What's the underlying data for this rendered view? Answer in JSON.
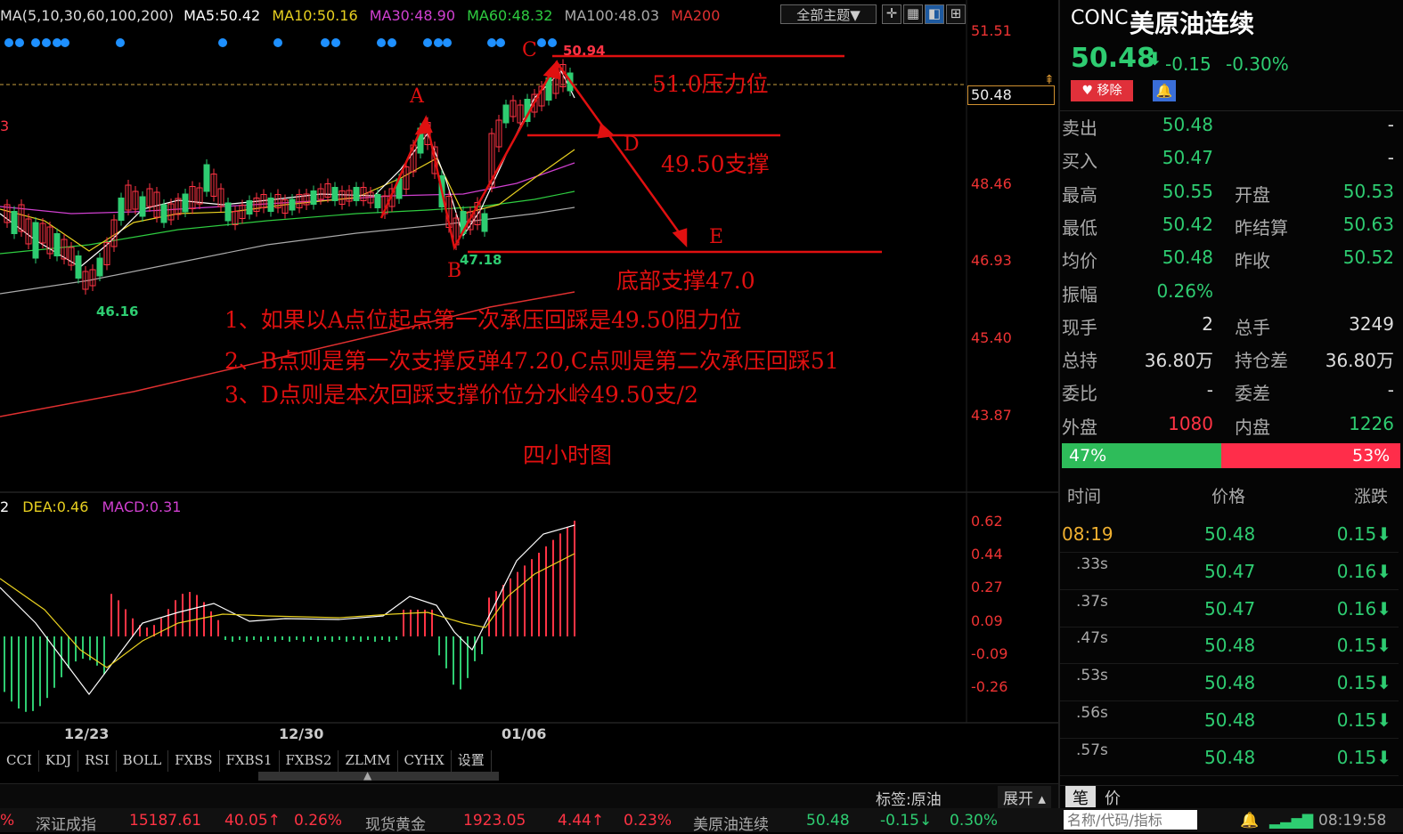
{
  "ma_legend": {
    "params": "MA(5,10,30,60,100,200)",
    "ma5": "MA5:50.42",
    "ma10": "MA10:50.16",
    "ma30": "MA30:48.90",
    "ma60": "MA60:48.32",
    "ma100": "MA100:48.03",
    "ma200": "MA200"
  },
  "toolbar": {
    "theme_label": "全部主题▼"
  },
  "price_axis": [
    "51.51",
    "48.46",
    "46.93",
    "45.40",
    "43.87"
  ],
  "current_price_tag": "50.48",
  "high_label": "50.94",
  "low_label_left": "46.16",
  "low_label_b": "47.18",
  "left_partial_label": "3",
  "points": {
    "a": "A",
    "b": "B",
    "c": "C",
    "d": "D",
    "e": "E"
  },
  "annotations": {
    "resistance": "51.0压力位",
    "support_mid": "49.50支撑",
    "support_bottom": "底部支撑47.0",
    "note1": "1、如果以A点位起点第一次承压回踩是49.50阻力位",
    "note2": "2、B点则是第一次支撑反弹47.20,C点则是第二次承压回踩51",
    "note3": "3、D点则是本次回踩支撑价位分水岭49.50支/2",
    "timeframe": "四小时图"
  },
  "macd_legend": {
    "dif_partial": "2",
    "dea": "DEA:0.46",
    "macd": "MACD:0.31"
  },
  "macd_axis": [
    "0.62",
    "0.44",
    "0.27",
    "0.09",
    "-0.09",
    "-0.26"
  ],
  "date_axis": [
    "12/23",
    "12/30",
    "01/06"
  ],
  "indicator_tabs": [
    "CCI",
    "KDJ",
    "RSI",
    "BOLL",
    "FXBS",
    "FXBS1",
    "FXBS2",
    "ZLMM",
    "CYHX",
    "设置"
  ],
  "bottom_bar": {
    "tag": "标签:原油",
    "expand": "展开 ▴"
  },
  "quote": {
    "code": "CONC",
    "name": "美原油连续",
    "price": "50.48",
    "arrow": "⬇",
    "change": "-0.15",
    "change_pct": "-0.30%",
    "remove_label": "移除",
    "rows": [
      {
        "l1": "卖出",
        "v1": "50.48",
        "l2": "",
        "v2": "-"
      },
      {
        "l1": "买入",
        "v1": "50.47",
        "l2": "",
        "v2": "-"
      },
      {
        "l1": "最高",
        "v1": "50.55",
        "l2": "开盘",
        "v2": "50.53"
      },
      {
        "l1": "最低",
        "v1": "50.42",
        "l2": "昨结算",
        "v2": "50.63"
      },
      {
        "l1": "均价",
        "v1": "50.48",
        "l2": "昨收",
        "v2": "50.52"
      },
      {
        "l1": "振幅",
        "v1": "0.26%",
        "l2": "",
        "v2": ""
      },
      {
        "l1": "现手",
        "v1": "2",
        "l2": "总手",
        "v2": "3249"
      },
      {
        "l1": "总持",
        "v1": "36.80万",
        "l2": "持仓差",
        "v2": "36.80万"
      },
      {
        "l1": "委比",
        "v1": "-",
        "l2": "委差",
        "v2": "-"
      },
      {
        "l1": "外盘",
        "v1": "1080",
        "l2": "内盘",
        "v2": "1226"
      }
    ],
    "buy_pct": "47%",
    "sell_pct": "53%",
    "buy_ratio": 0.47,
    "tick_headers": {
      "time": "时间",
      "price": "价格",
      "change": "涨跌"
    },
    "ticks": [
      {
        "time": "08:19",
        "price": "50.48",
        "chg": "0.15⬇"
      },
      {
        "time": ".33s",
        "price": "50.47",
        "chg": "0.16⬇"
      },
      {
        "time": ".37s",
        "price": "50.47",
        "chg": "0.16⬇"
      },
      {
        "time": ".47s",
        "price": "50.48",
        "chg": "0.15⬇"
      },
      {
        "time": ".53s",
        "price": "50.48",
        "chg": "0.15⬇"
      },
      {
        "time": ".56s",
        "price": "50.48",
        "chg": "0.15⬇"
      },
      {
        "time": ".57s",
        "price": "50.48",
        "chg": "0.15⬇"
      }
    ],
    "bottom_tabs": {
      "tab1": "笔",
      "tab2": "价"
    }
  },
  "status_bar": {
    "pct0": "%",
    "idx1_name": "深证成指",
    "idx1_val": "15187.61",
    "idx1_chg": "40.05↑",
    "idx1_pct": "0.26%",
    "idx2_name": "现货黄金",
    "idx2_val": "1923.05",
    "idx2_chg": "4.44↑",
    "idx2_pct": "0.23%",
    "idx3_name": "美原油连续",
    "idx3_val": "50.48",
    "idx3_chg": "-0.15↓",
    "idx3_pct": "0.30%",
    "search_placeholder": "名称/代码/指标",
    "clock": "08:19:58"
  },
  "colors": {
    "up": "#ff3344",
    "down": "#2ecc71",
    "annotation": "#e01010"
  }
}
